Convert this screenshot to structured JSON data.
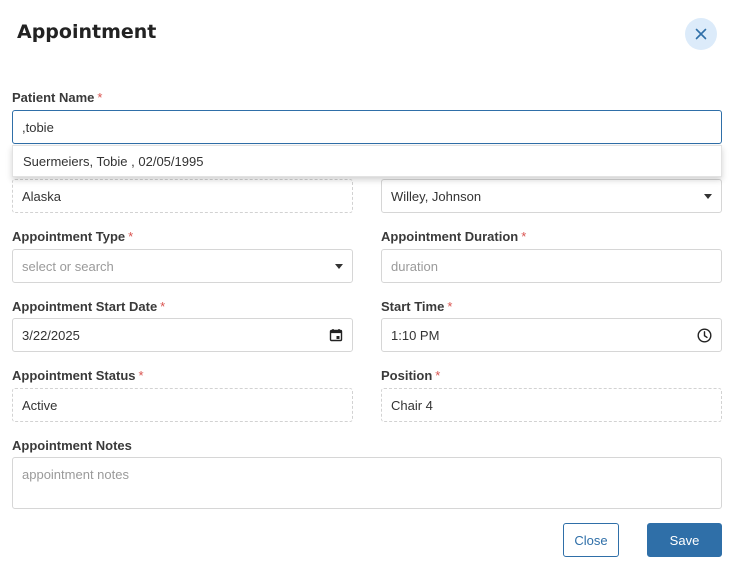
{
  "dialog": {
    "title": "Appointment"
  },
  "patient": {
    "label": "Patient Name",
    "value": ",tobie",
    "suggestion": "Suermeiers, Tobie , 02/05/1995"
  },
  "location": {
    "value": "Alaska"
  },
  "provider": {
    "value": "Willey, Johnson"
  },
  "appointment_type": {
    "label": "Appointment Type",
    "placeholder": "select or search"
  },
  "duration": {
    "label": "Appointment Duration",
    "placeholder": "duration"
  },
  "start_date": {
    "label": "Appointment Start Date",
    "value": "3/22/2025"
  },
  "start_time": {
    "label": "Start Time",
    "value": "1:10 PM"
  },
  "status": {
    "label": "Appointment Status",
    "value": "Active"
  },
  "position": {
    "label": "Position",
    "value": "Chair 4"
  },
  "notes": {
    "label": "Appointment Notes",
    "placeholder": "appointment notes"
  },
  "buttons": {
    "close": "Close",
    "save": "Save"
  },
  "required_marker": "*",
  "colors": {
    "primary": "#2f6fa8",
    "required": "#d9534f",
    "close_bg": "#dcebfa"
  },
  "icons": {
    "dialog_close": "close-icon",
    "select_arrow": "caret-down-icon",
    "date": "calendar-icon",
    "time": "clock-icon"
  }
}
